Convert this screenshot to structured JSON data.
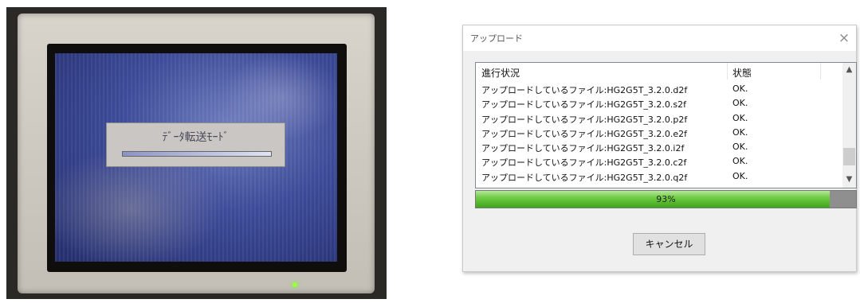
{
  "photo": {
    "hmi_message": "ﾃﾞｰﾀ転送ﾓｰﾄﾞ",
    "led_color": "#9cff3a"
  },
  "dialog": {
    "title": "アップロード",
    "close_glyph": "×",
    "columns": [
      "進行状況",
      "状態"
    ],
    "rows": [
      {
        "file": "アップロードしているファイル:HG2G5T_3.2.0.d2f",
        "status": "OK."
      },
      {
        "file": "アップロードしているファイル:HG2G5T_3.2.0.s2f",
        "status": "OK."
      },
      {
        "file": "アップロードしているファイル:HG2G5T_3.2.0.p2f",
        "status": "OK."
      },
      {
        "file": "アップロードしているファイル:HG2G5T_3.2.0.e2f",
        "status": "OK."
      },
      {
        "file": "アップロードしているファイル:HG2G5T_3.2.0.i2f",
        "status": "OK."
      },
      {
        "file": "アップロードしているファイル:HG2G5T_3.2.0.c2f",
        "status": "OK."
      },
      {
        "file": "アップロードしているファイル:HG2G5T_3.2.0.q2f",
        "status": "OK."
      }
    ],
    "progress": {
      "value": 0.93,
      "label": "93%"
    },
    "cancel_label": "キャンセル"
  },
  "colors": {
    "progress_green": "#3ea51a",
    "accent_blue": "#3c4a98"
  }
}
